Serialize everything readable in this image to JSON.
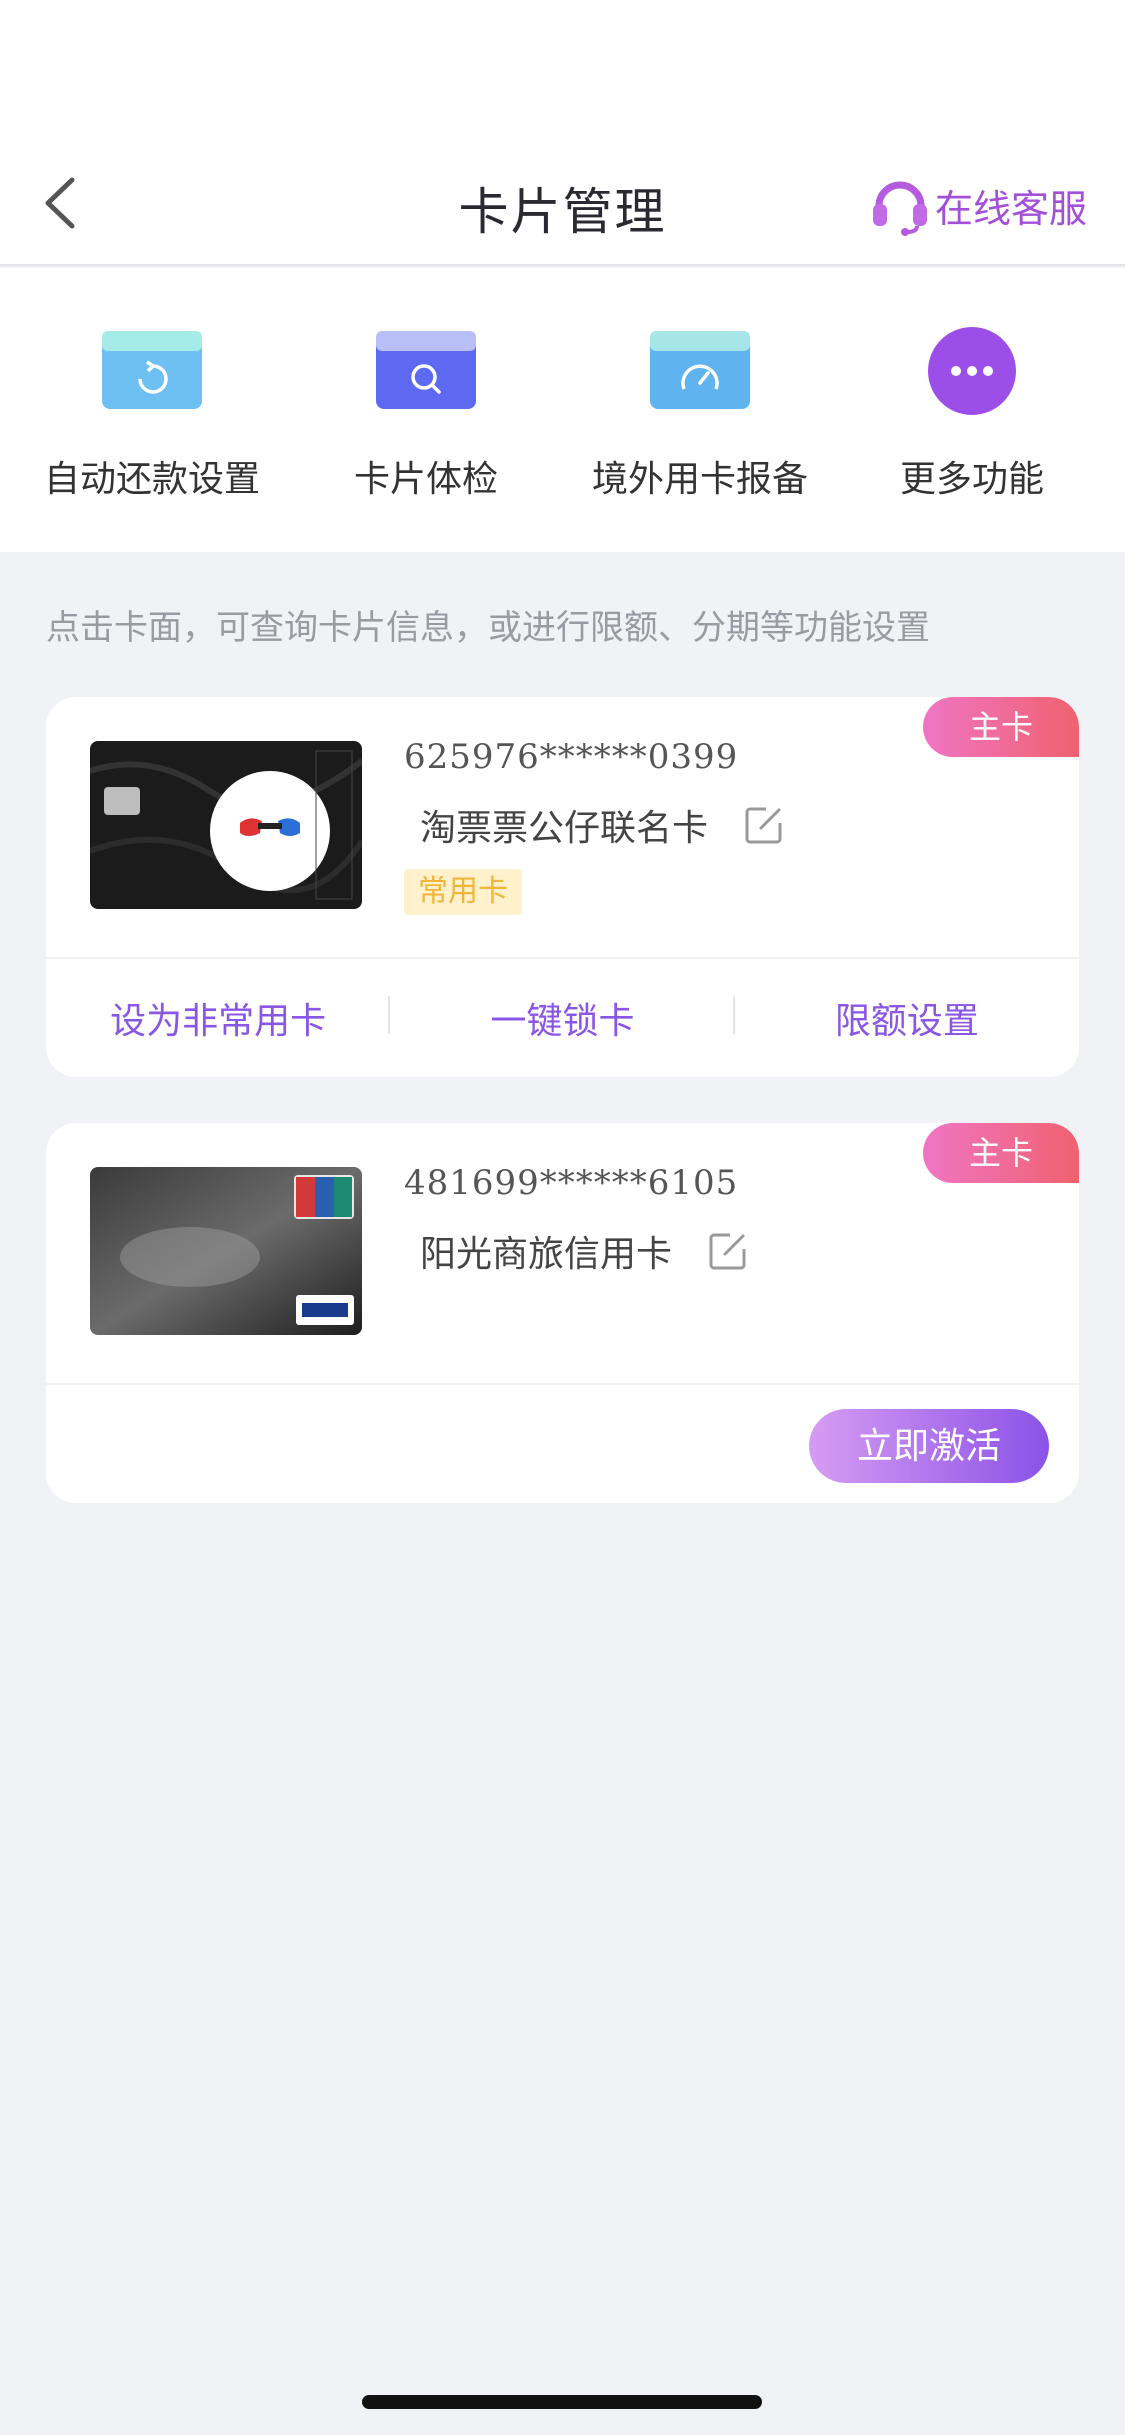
{
  "nav": {
    "title": "卡片管理",
    "service_label": "在线客服"
  },
  "quick_actions": [
    {
      "label": "自动还款设置",
      "icon": "auto-repay-icon"
    },
    {
      "label": "卡片体检",
      "icon": "card-checkup-icon"
    },
    {
      "label": "境外用卡报备",
      "icon": "overseas-report-icon"
    },
    {
      "label": "更多功能",
      "icon": "more-icon"
    }
  ],
  "hint": "点击卡面，可查询卡片信息，或进行限额、分期等功能设置",
  "cards": [
    {
      "badge": "主卡",
      "number": "625976******0399",
      "name": "淘票票公仔联名卡",
      "tag": "常用卡",
      "actions": [
        "设为非常用卡",
        "一键锁卡",
        "限额设置"
      ]
    },
    {
      "badge": "主卡",
      "number": "481699******6105",
      "name": "阳光商旅信用卡",
      "activate_label": "立即激活"
    }
  ],
  "colors": {
    "accent": "#8a56e6",
    "service": "#a44fd8",
    "badge_start": "#f075c4",
    "badge_end": "#f0626f",
    "tag_bg": "#fff1cc",
    "tag_text": "#f2b53a"
  }
}
